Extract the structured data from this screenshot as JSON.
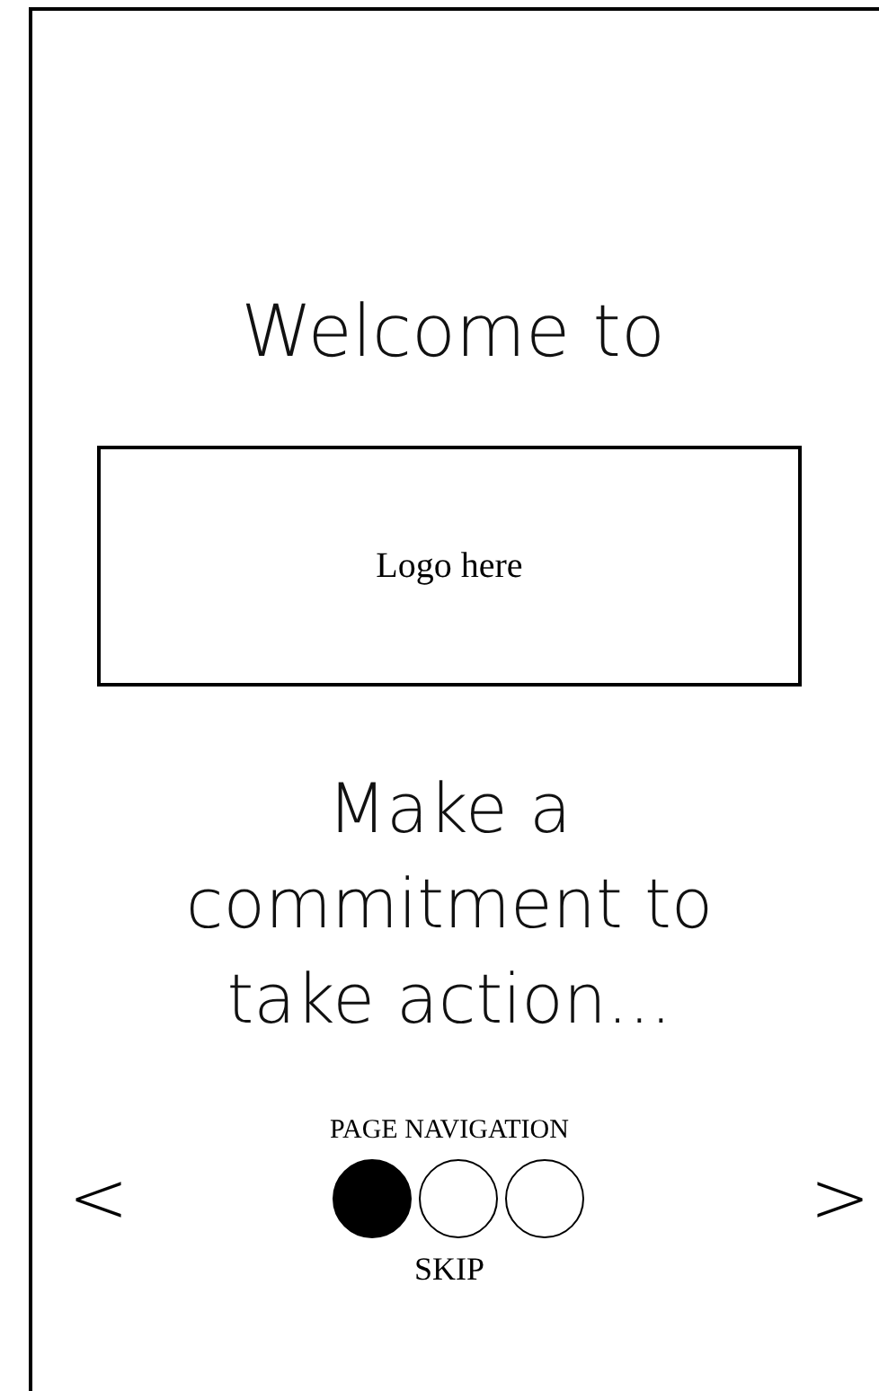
{
  "welcome": "Welcome to",
  "logo": {
    "label": "Logo here"
  },
  "tagline": "Make a commitment to take action...",
  "navigation": {
    "label": "PAGE NAVIGATION",
    "prev": "<",
    "next": ">",
    "dots": [
      {
        "selected": true
      },
      {
        "selected": false
      },
      {
        "selected": false
      }
    ],
    "skip": "SKIP"
  }
}
